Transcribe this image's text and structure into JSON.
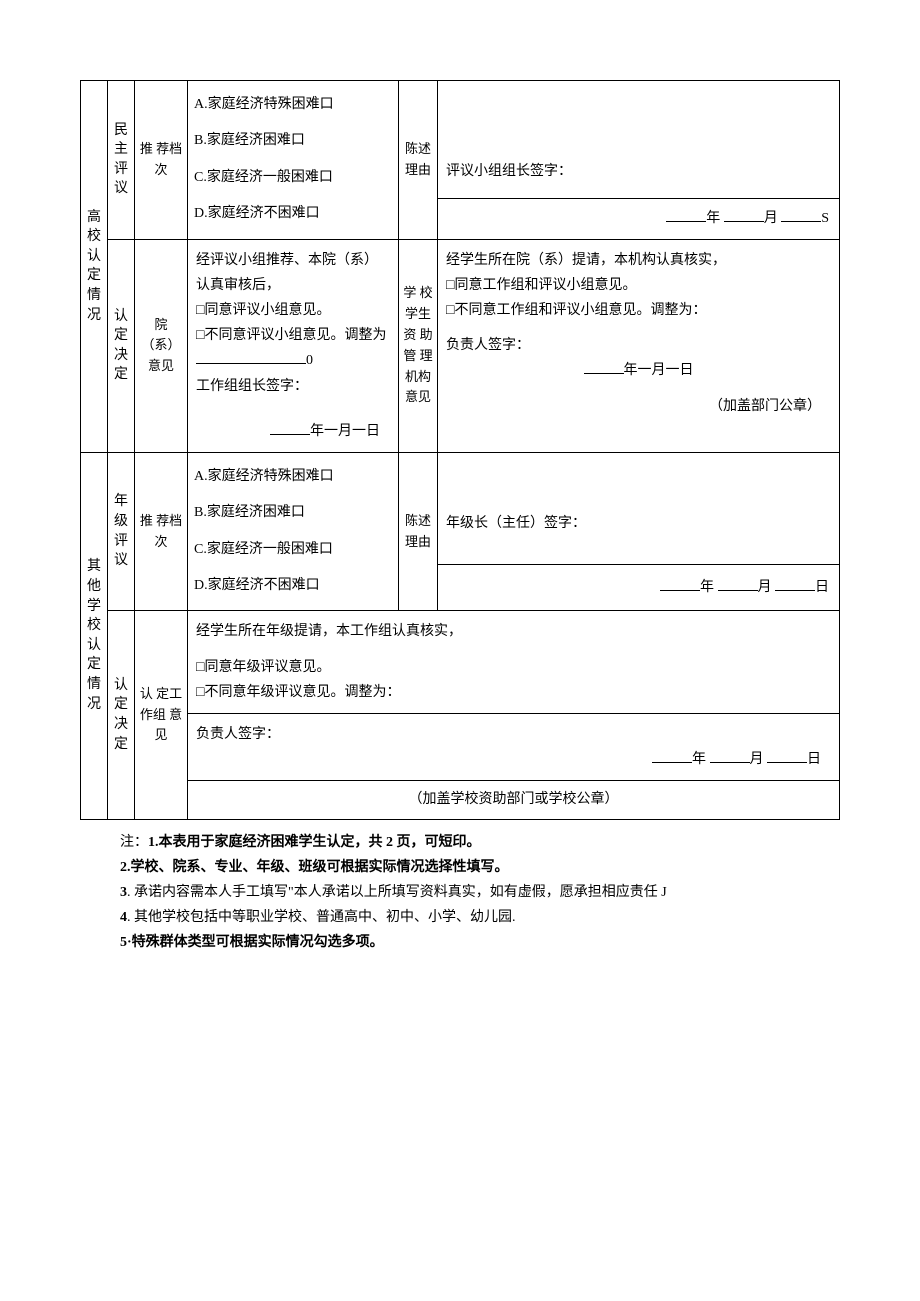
{
  "sectionA": {
    "title": "高校认定情况",
    "row1": {
      "label": "民主评议",
      "col1": "推 荐档次",
      "optA": "A.家庭经济特殊困难口",
      "optB": "B.家庭经济困难口",
      "optC": "C.家庭经济一般困难口",
      "optD": "D.家庭经济不困难口",
      "col3": "陈述理由",
      "sig": "评议小组组长签字：",
      "dateY": "年",
      "dateM": "月",
      "dateD": "S"
    },
    "row2": {
      "label": "认定决定",
      "col1": "院（系）意见",
      "l1": "经评议小组推荐、本院（系）认真审核后，",
      "l2": "□同意评议小组意见。",
      "l3": "□不同意评议小组意见。调整为",
      "zero": "0",
      "l4": "工作组组长签字：",
      "date": "年一月一日",
      "col3": "学 校 学生 资 助管 理 机构意见",
      "r1": "经学生所在院（系）提请，本机构认真核实，",
      "r2": "□同意工作组和评议小组意见。",
      "r3": "□不同意工作组和评议小组意见。调整为：",
      "r4": "负责人签字：",
      "rdate": "年一月一日",
      "seal": "（加盖部门公章）"
    }
  },
  "sectionB": {
    "title": "其他学校认定情况",
    "row1": {
      "label": "年级评议",
      "col1": "推 荐档次",
      "optA": "A.家庭经济特殊困难口",
      "optB": "B.家庭经济困难口",
      "optC": "C.家庭经济一般困难口",
      "optD": "D.家庭经济不困难口",
      "col3": "陈述理由",
      "sig": "年级长（主任）签字：",
      "dateY": "年",
      "dateM": "月",
      "dateD": "日"
    },
    "row2": {
      "label": "认定决定",
      "col1": "认 定工 作组 意见",
      "l1": "经学生所在年级提请，本工作组认真核实，",
      "l2": "□同意年级评议意见。",
      "l3": "□不同意年级评议意见。调整为：",
      "l4": "负责人签字：",
      "dateY": "年",
      "dateM": "月",
      "dateD": "日",
      "seal": "（加盖学校资助部门或学校公章）"
    }
  },
  "notes": {
    "prefix": "注：",
    "n1": "1.本表用于家庭经济困难学生认定，共 2 页，可短印。",
    "n2": "2.学校、院系、专业、年级、班级可根据实际情况选择性填写。",
    "n3a": "3",
    "n3b": ". 承诺内容需本人手工填写\"本人承诺以上所填写资料真实，如有虚假，愿承担相应责任 J",
    "n4a": "4",
    "n4b": ". 其他学校包括中等职业学校、普通高中、初中、小学、幼儿园.",
    "n5": "5·特殊群体类型可根据实际情况勾选多项。"
  }
}
